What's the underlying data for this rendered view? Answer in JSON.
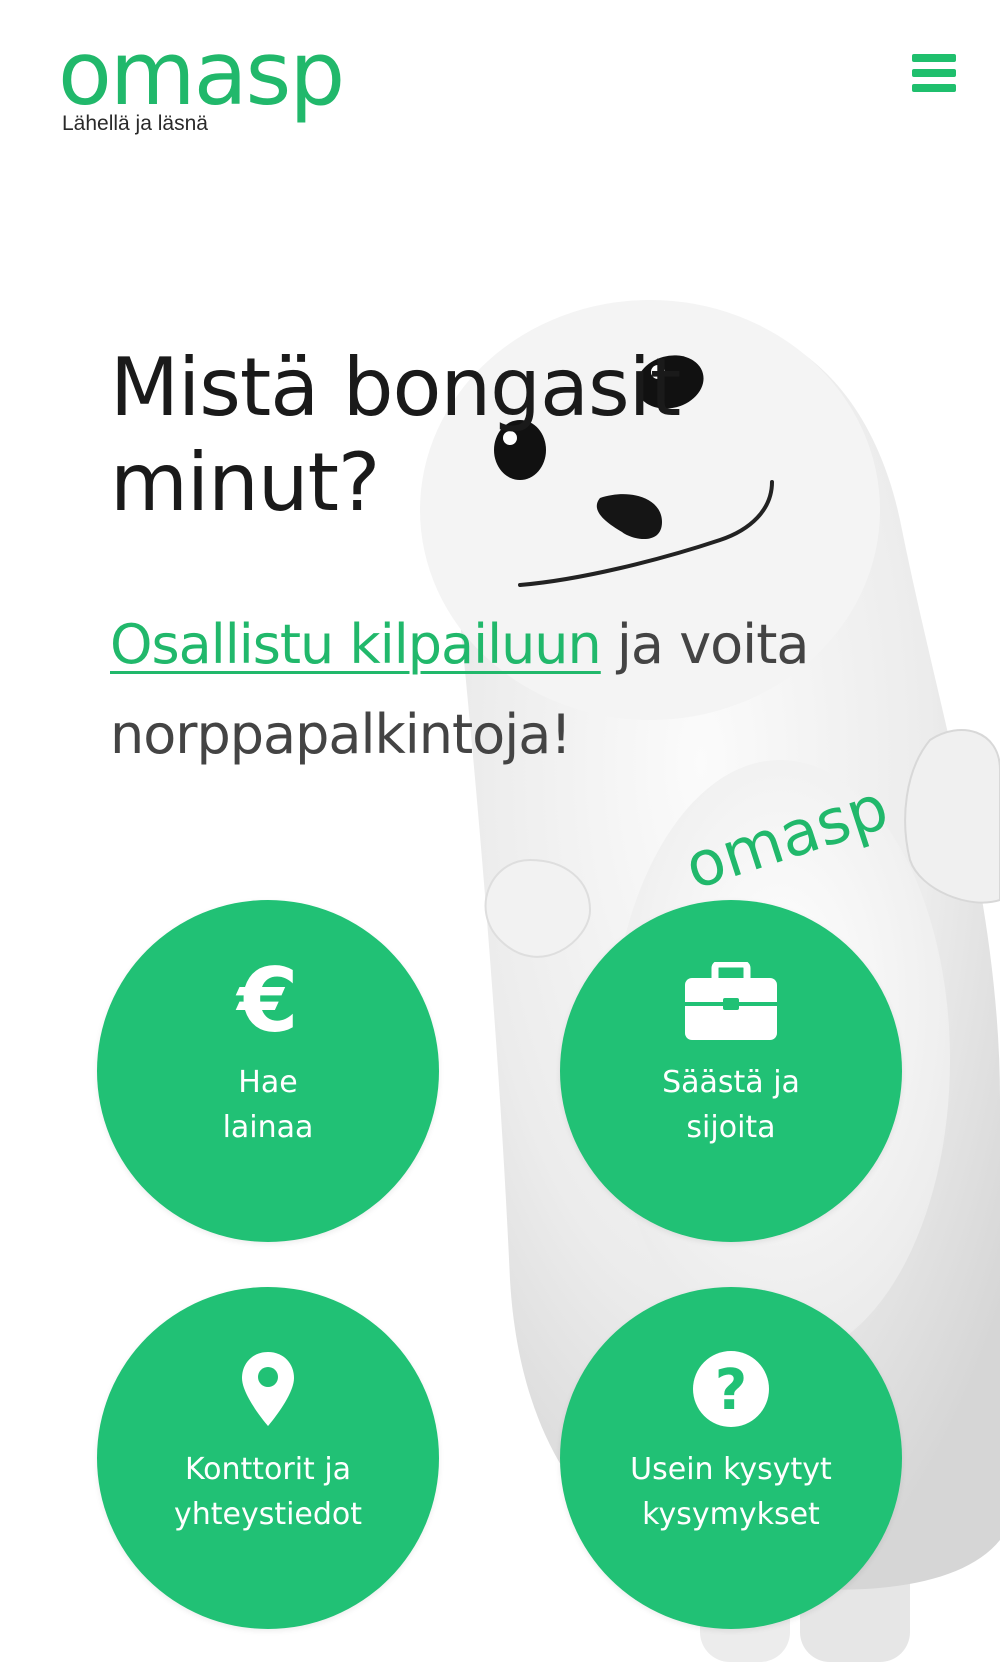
{
  "header": {
    "logo_text": "omasp",
    "tagline": "Lähellä ja läsnä",
    "menu_icon": "hamburger-menu-icon"
  },
  "hero": {
    "title_line1": "Mistä bongasit",
    "title_line2": "minut?",
    "link_text": "Osallistu kilpailuun",
    "sub_text_rest": " ja voita norppapalkintoja!"
  },
  "mascot": {
    "badge_text": "omasp"
  },
  "services": [
    {
      "icon": "euro-icon",
      "line1": "Hae",
      "line2": "lainaa"
    },
    {
      "icon": "briefcase-icon",
      "line1": "Säästä ja",
      "line2": "sijoita"
    },
    {
      "icon": "map-pin-icon",
      "line1": "Konttorit ja",
      "line2": "yhteystiedot"
    },
    {
      "icon": "question-circle-icon",
      "line1": "Usein kysytyt",
      "line2": "kysymykset"
    }
  ],
  "colors": {
    "brand_green": "#21b86b",
    "circle_green": "#21c175",
    "text_dark": "#1a1a1a",
    "text_gray": "#444444"
  }
}
